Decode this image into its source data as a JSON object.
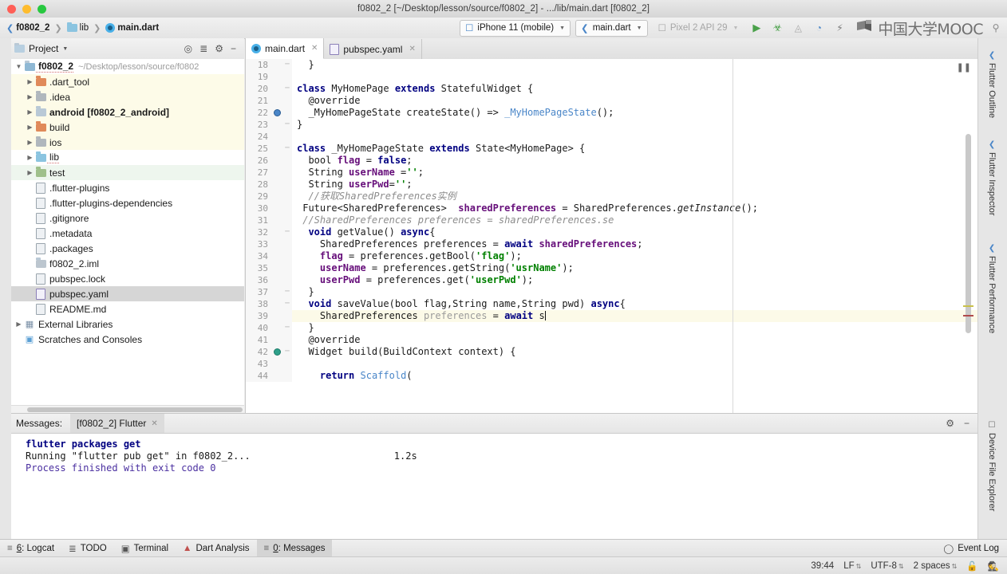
{
  "window": {
    "title": "f0802_2 [~/Desktop/lesson/source/f0802_2] - .../lib/main.dart [f0802_2]"
  },
  "navbar": {
    "breadcrumbs": [
      {
        "label": "f0802_2",
        "icon": "dart-project-icon"
      },
      {
        "label": "lib",
        "icon": "folder-icon"
      },
      {
        "label": "main.dart",
        "icon": "dart-file-icon"
      }
    ],
    "device_selector": {
      "label": "iPhone 11 (mobile)",
      "icon": "phone-icon"
    },
    "run_config_selector": {
      "label": "main.dart",
      "icon": "flutter-icon"
    },
    "avd_selector": {
      "label": "Pixel 2 API 29",
      "icon": "android-device-icon",
      "disabled": true
    },
    "actions": [
      {
        "name": "run-button",
        "glyph": "▶",
        "color": "#4aa14a"
      },
      {
        "name": "debug-button",
        "glyph": "☢",
        "color": "#4aa14a"
      },
      {
        "name": "profile-button",
        "glyph": "◴",
        "color": "#9a9a9a"
      },
      {
        "name": "devtools-button",
        "glyph": "◔",
        "color": "#4a86c8"
      },
      {
        "name": "hot-reload-button",
        "glyph": "⚡",
        "color": "#7a7a7a"
      }
    ],
    "watermark": "中国大学MOOC"
  },
  "project_panel": {
    "title": "Project",
    "actions": [
      "locate-icon",
      "collapse-all-icon",
      "settings-gear-icon",
      "hide-icon"
    ],
    "tree": [
      {
        "indent": 0,
        "twisty": "▼",
        "icon": "project-folder-icon",
        "label": "f0802_2",
        "path": "~/Desktop/lesson/source/f0802",
        "bold": true,
        "underline": true,
        "highlight": "none"
      },
      {
        "indent": 1,
        "twisty": "▶",
        "icon": "folder-orange-icon",
        "label": ".dart_tool",
        "highlight": "yellow"
      },
      {
        "indent": 1,
        "twisty": "▶",
        "icon": "folder-gray-icon",
        "label": ".idea",
        "highlight": "yellow"
      },
      {
        "indent": 1,
        "twisty": "▶",
        "icon": "folder-icon",
        "label": "android [f0802_2_android]",
        "bold_part": "[f0802_2_android]",
        "highlight": "yellow"
      },
      {
        "indent": 1,
        "twisty": "▶",
        "icon": "folder-orange-icon",
        "label": "build",
        "highlight": "yellow"
      },
      {
        "indent": 1,
        "twisty": "▶",
        "icon": "folder-gray-icon",
        "label": "ios",
        "highlight": "yellow"
      },
      {
        "indent": 1,
        "twisty": "▶",
        "icon": "folder-blue-icon",
        "label": "lib",
        "underline": true,
        "highlight": "none"
      },
      {
        "indent": 1,
        "twisty": "▶",
        "icon": "folder-green-icon",
        "label": "test",
        "highlight": "green"
      },
      {
        "indent": 1,
        "twisty": "",
        "icon": "file-icon",
        "label": ".flutter-plugins"
      },
      {
        "indent": 1,
        "twisty": "",
        "icon": "file-icon",
        "label": ".flutter-plugins-dependencies"
      },
      {
        "indent": 1,
        "twisty": "",
        "icon": "file-icon",
        "label": ".gitignore"
      },
      {
        "indent": 1,
        "twisty": "",
        "icon": "file-icon",
        "label": ".metadata"
      },
      {
        "indent": 1,
        "twisty": "",
        "icon": "file-icon",
        "label": ".packages"
      },
      {
        "indent": 1,
        "twisty": "",
        "icon": "iml-file-icon",
        "label": "f0802_2.iml"
      },
      {
        "indent": 1,
        "twisty": "",
        "icon": "file-icon",
        "label": "pubspec.lock"
      },
      {
        "indent": 1,
        "twisty": "",
        "icon": "yaml-file-icon",
        "label": "pubspec.yaml",
        "selected": true
      },
      {
        "indent": 1,
        "twisty": "",
        "icon": "file-icon",
        "label": "README.md"
      },
      {
        "indent": 0,
        "twisty": "▶",
        "icon": "library-icon",
        "label": "External Libraries"
      },
      {
        "indent": 0,
        "twisty": "",
        "icon": "scratches-icon",
        "label": "Scratches and Consoles"
      }
    ]
  },
  "editor": {
    "tabs": [
      {
        "label": "main.dart",
        "icon": "dart-file-icon",
        "active": true
      },
      {
        "label": "pubspec.yaml",
        "icon": "yaml-file-icon",
        "active": false
      }
    ],
    "first_line_number": 18,
    "lines": [
      {
        "n": 18,
        "marker": "",
        "fold": "─",
        "html": "  }"
      },
      {
        "n": 19,
        "marker": "",
        "fold": "",
        "html": ""
      },
      {
        "n": 20,
        "marker": "",
        "fold": "─",
        "html": "<span class='k'>class</span> <span class='cls'>MyHomePage</span> <span class='k'>extends</span> <span class='cls'>StatefulWidget</span> {"
      },
      {
        "n": 21,
        "marker": "",
        "fold": "",
        "html": "  @override"
      },
      {
        "n": 22,
        "marker": "override-up",
        "fold": "",
        "html": "  _MyHomePageState createState() =&gt; <span class='lnk'>_MyHomePageState</span>();"
      },
      {
        "n": 23,
        "marker": "",
        "fold": "─",
        "html": "}"
      },
      {
        "n": 24,
        "marker": "",
        "fold": "",
        "html": ""
      },
      {
        "n": 25,
        "marker": "",
        "fold": "─",
        "html": "<span class='k'>class</span> <span class='cls'>_MyHomePageState</span> <span class='k'>extends</span> <span class='cls'>State&lt;MyHomePage&gt;</span> {"
      },
      {
        "n": 26,
        "marker": "",
        "fold": "",
        "html": "  bool <span class='id'>flag</span> = <span class='k'>false</span>;"
      },
      {
        "n": 27,
        "marker": "",
        "fold": "",
        "html": "  String <span class='id'>userName</span> =<span class='str'>''</span>;"
      },
      {
        "n": 28,
        "marker": "",
        "fold": "",
        "html": "  String <span class='id'>userPwd</span>=<span class='str'>''</span>;"
      },
      {
        "n": 29,
        "marker": "",
        "fold": "",
        "html": "  <span class='cm'>//获取SharedPreferences实例</span>"
      },
      {
        "n": 30,
        "marker": "",
        "fold": "",
        "html": " Future&lt;SharedPreferences&gt;  <span class='id'>sharedPreferences</span> = SharedPreferences.<span class='it'>getInstance</span>();"
      },
      {
        "n": 31,
        "marker": "",
        "fold": "",
        "html": " <span class='cm'>//SharedPreferences preferences = sharedPreferences.se</span>"
      },
      {
        "n": 32,
        "marker": "",
        "fold": "─",
        "html": "  <span class='k'>void</span> getValue() <span class='k'>async</span>{"
      },
      {
        "n": 33,
        "marker": "",
        "fold": "",
        "html": "    SharedPreferences preferences = <span class='k'>await</span> <span class='id'>sharedPreferences</span>;"
      },
      {
        "n": 34,
        "marker": "",
        "fold": "",
        "html": "    <span class='id'>flag</span> = preferences.getBool(<span class='str'>'flag'</span>);"
      },
      {
        "n": 35,
        "marker": "",
        "fold": "",
        "html": "    <span class='id'>userName</span> = preferences.getString(<span class='str'>'usrName'</span>);"
      },
      {
        "n": 36,
        "marker": "",
        "fold": "",
        "html": "    <span class='id'>userPwd</span> = preferences.get(<span class='str'>'userPwd'</span>);"
      },
      {
        "n": 37,
        "marker": "",
        "fold": "─",
        "html": "  }"
      },
      {
        "n": 38,
        "marker": "",
        "fold": "─",
        "html": "  <span class='k'>void</span> saveValue(bool flag,String name,String pwd) <span class='k'>async</span>{"
      },
      {
        "n": 39,
        "marker": "",
        "fold": "",
        "highlight": true,
        "html": "    SharedPreferences <span class='gray'>preferences</span> = <span class='k'>await</span> s<span class='caret'></span>"
      },
      {
        "n": 40,
        "marker": "",
        "fold": "─",
        "html": "  }"
      },
      {
        "n": 41,
        "marker": "",
        "fold": "",
        "html": "  @override"
      },
      {
        "n": 42,
        "marker": "override-teal",
        "fold": "─",
        "html": "  Widget build(BuildContext context) {"
      },
      {
        "n": 43,
        "marker": "",
        "fold": "",
        "html": ""
      },
      {
        "n": 44,
        "marker": "",
        "fold": "",
        "html": "    <span class='k'>return</span> <span class='lnk'>Scaffold</span>("
      }
    ]
  },
  "messages_panel": {
    "label": "Messages:",
    "tab": "[f0802_2] Flutter",
    "lines": [
      {
        "text": "flutter packages get",
        "style": "bold",
        "duration": ""
      },
      {
        "text": "Running \"flutter pub get\" in f0802_2...",
        "style": "plain",
        "duration": "1.2s"
      },
      {
        "text": "Process finished with exit code 0",
        "style": "purple",
        "duration": ""
      }
    ],
    "actions": [
      "settings-gear-icon",
      "hide-icon"
    ]
  },
  "right_rail": {
    "top_items": [
      "Flutter Outline",
      "Flutter Inspector",
      "Flutter Performance"
    ],
    "bottom_items": [
      "Device File Explorer"
    ]
  },
  "tool_window_bar": {
    "items": [
      {
        "key": "6",
        "label": "Logcat",
        "icon": "logcat-icon",
        "active": false
      },
      {
        "key": "",
        "label": "TODO",
        "icon": "todo-icon",
        "active": false
      },
      {
        "key": "",
        "label": "Terminal",
        "icon": "terminal-icon",
        "active": false
      },
      {
        "key": "",
        "label": "Dart Analysis",
        "icon": "dart-analysis-icon",
        "active": false
      },
      {
        "key": "0",
        "label": "Messages",
        "icon": "messages-icon",
        "active": true
      }
    ],
    "event_log": {
      "label": "Event Log",
      "icon": "event-log-icon"
    }
  },
  "status_bar": {
    "caret_position": "39:44",
    "line_separator": "LF",
    "encoding": "UTF-8",
    "indent": "2 spaces",
    "lock_icon": "unlock-icon",
    "hector_icon": "inspection-icon"
  }
}
